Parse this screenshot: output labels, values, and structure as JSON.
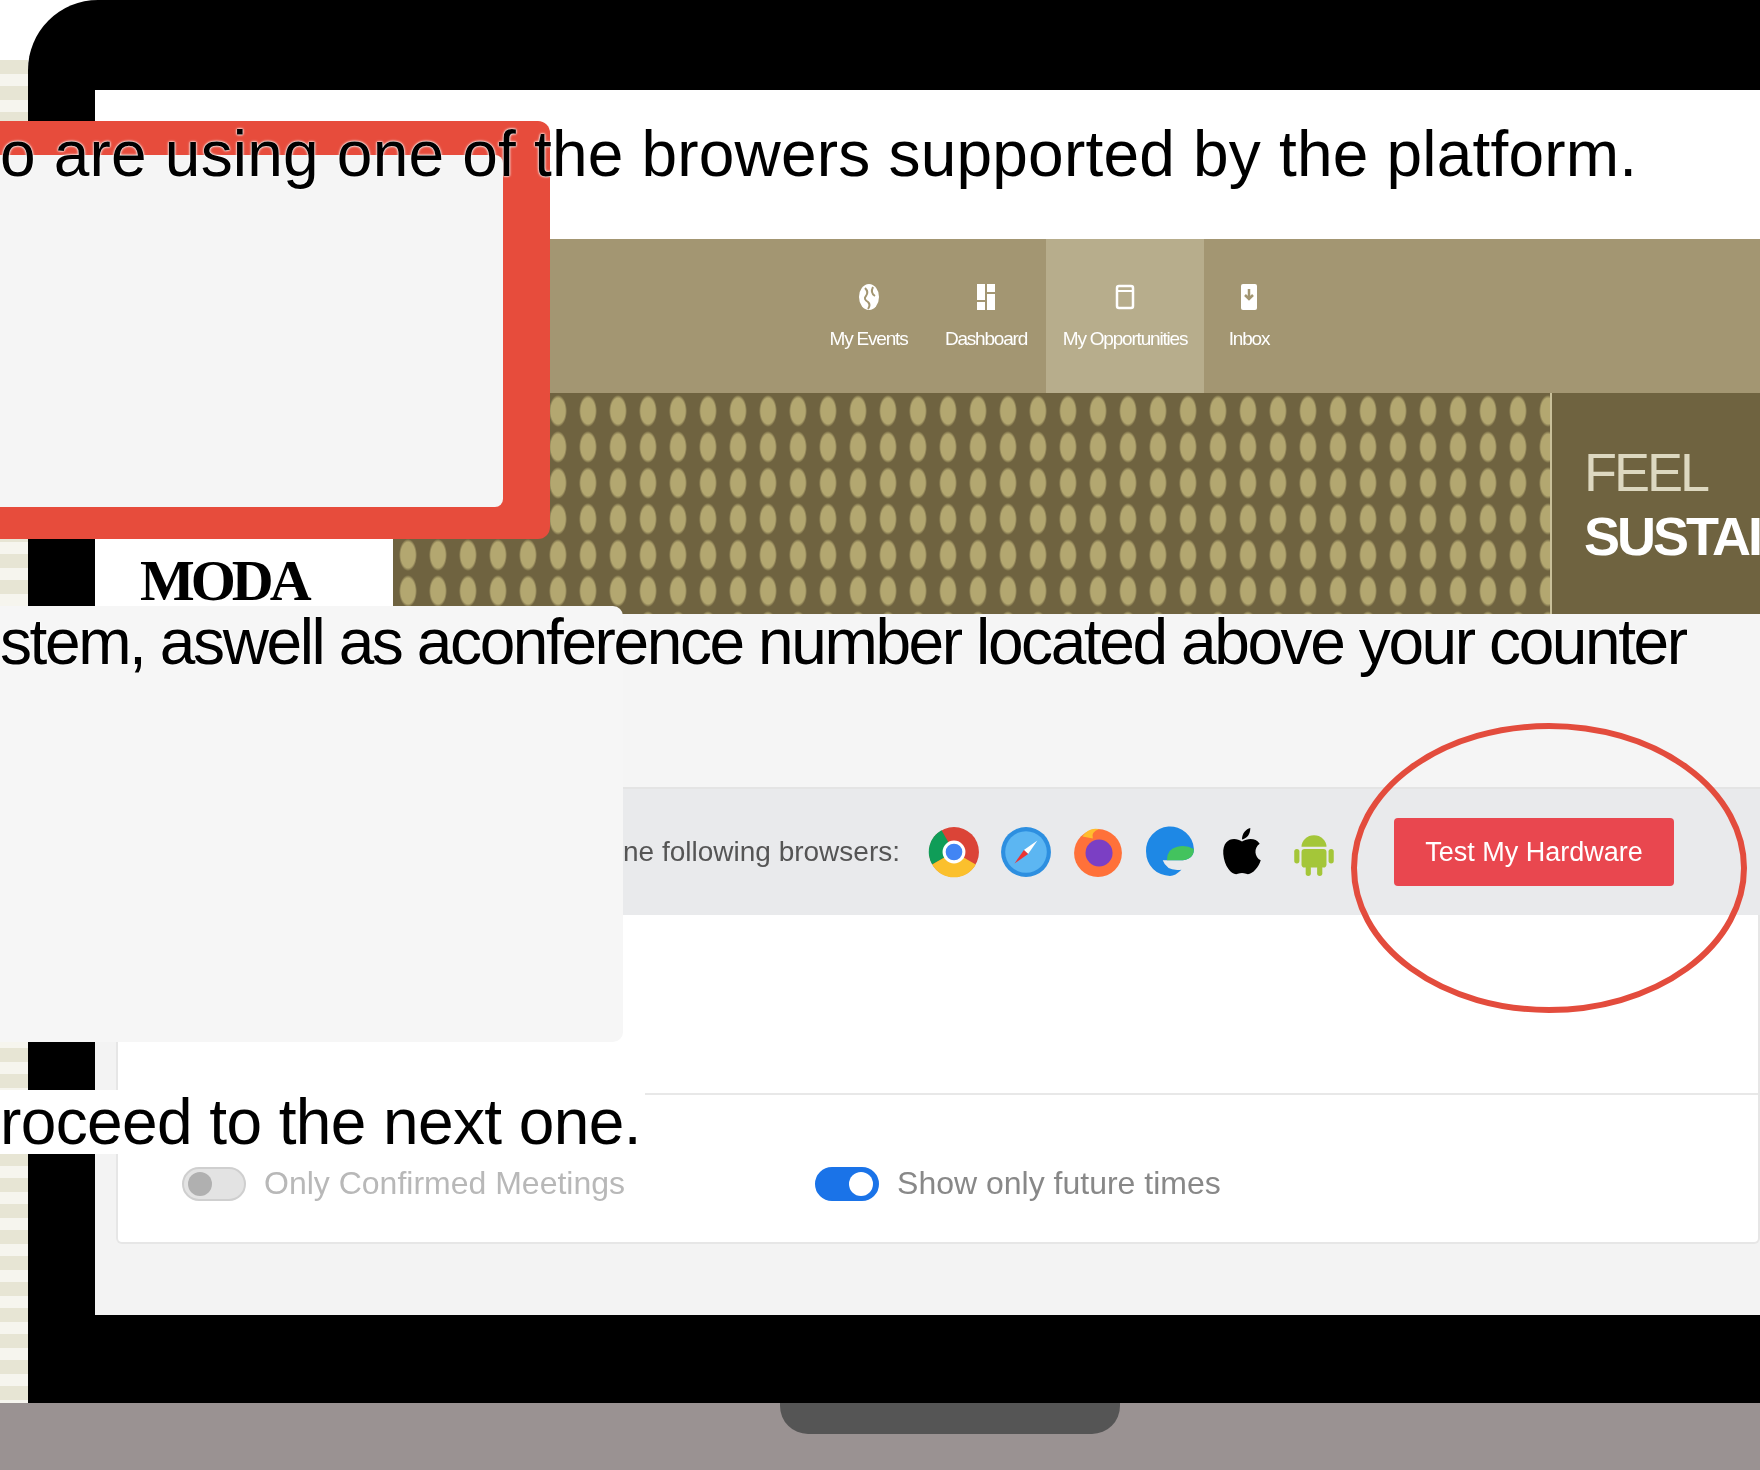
{
  "nav": {
    "items": [
      {
        "label": "My Events",
        "selected": false
      },
      {
        "label": "Dashboard",
        "selected": false
      },
      {
        "label": "My Opportunities",
        "selected": true
      },
      {
        "label": "Inbox",
        "selected": false
      }
    ]
  },
  "banner": {
    "logo": "MODA",
    "headline": [
      "FEEL",
      "SUSTAI"
    ]
  },
  "browsers_bar": {
    "text": "ne following browsers:",
    "button": "Test My Hardware"
  },
  "toggles": [
    {
      "label": "Only Confirmed Meetings",
      "on": false
    },
    {
      "label": "Show only future times",
      "on": true
    }
  ],
  "overlay_texts": [
    "o are using one of the browers supported by the platform.",
    "stem, aswell as aconference number located above your counter",
    "roceed to the next one."
  ]
}
